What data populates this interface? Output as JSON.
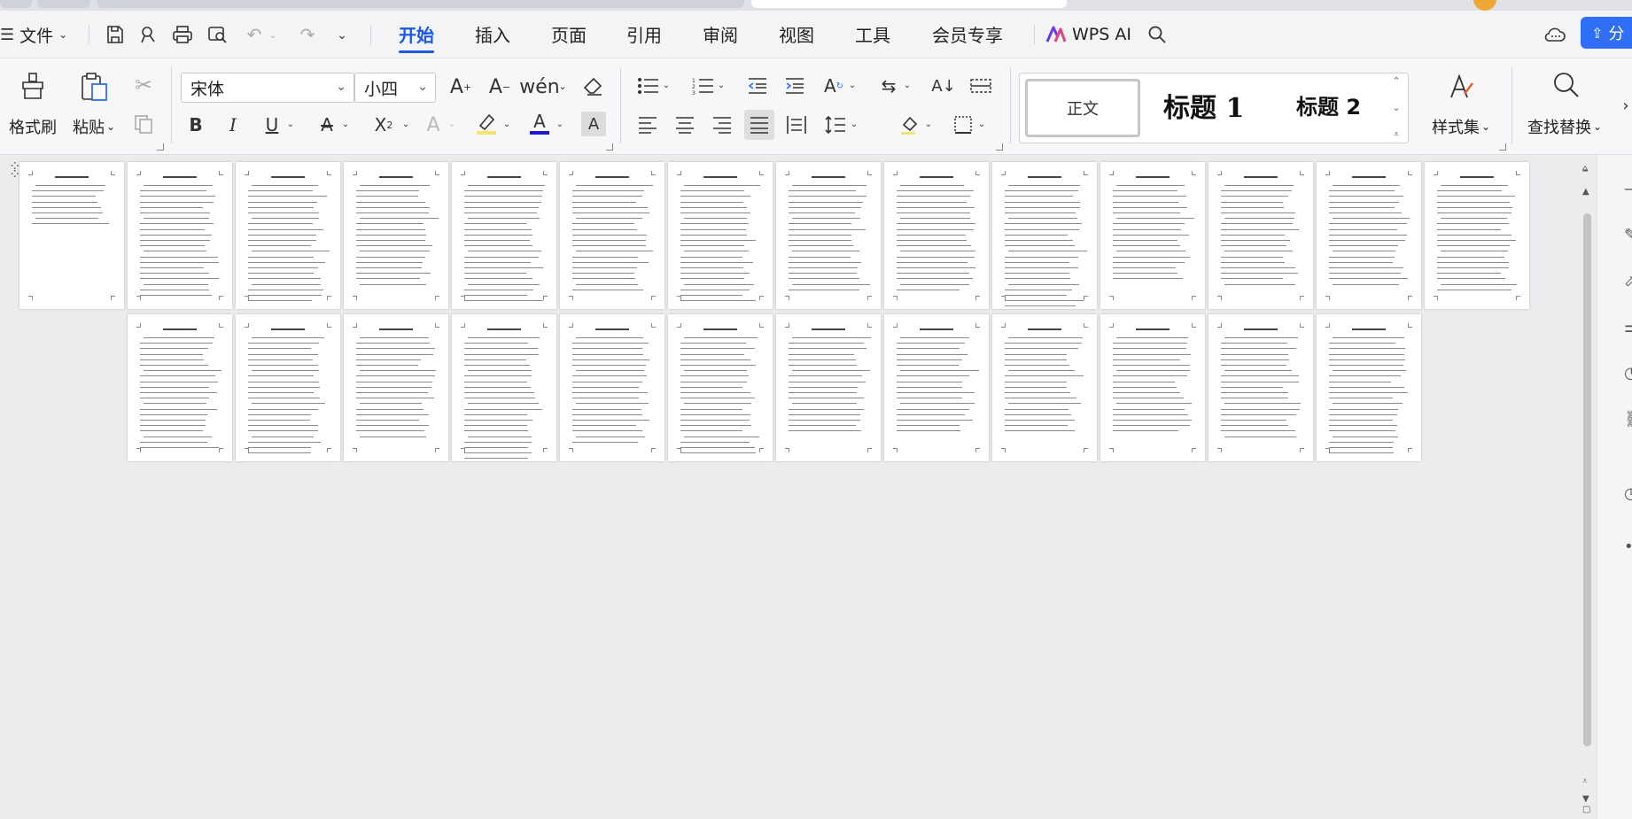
{
  "menubar": {
    "file_label": "文件",
    "tabs": [
      {
        "label": "开始",
        "active": true
      },
      {
        "label": "插入",
        "active": false
      },
      {
        "label": "页面",
        "active": false
      },
      {
        "label": "引用",
        "active": false
      },
      {
        "label": "审阅",
        "active": false
      },
      {
        "label": "视图",
        "active": false
      },
      {
        "label": "工具",
        "active": false
      },
      {
        "label": "会员专享",
        "active": false
      }
    ],
    "wps_ai_label": "WPS AI",
    "share_label": "分"
  },
  "ribbon": {
    "format_painter_label": "格式刷",
    "paste_label": "粘贴",
    "font_name": "宋体",
    "font_size": "小四",
    "styles": {
      "normal": "正文",
      "heading1": "标题 1",
      "heading2": "标题 2"
    },
    "style_set_label": "样式集",
    "find_replace_label": "查找替换"
  },
  "document": {
    "view": "thumbnail-pages",
    "page_count": 26
  },
  "colors": {
    "accent": "#1a56e8",
    "share_button": "#2f6ef5",
    "font_color": "#1a1acc",
    "highlight": "#f3e56b"
  }
}
